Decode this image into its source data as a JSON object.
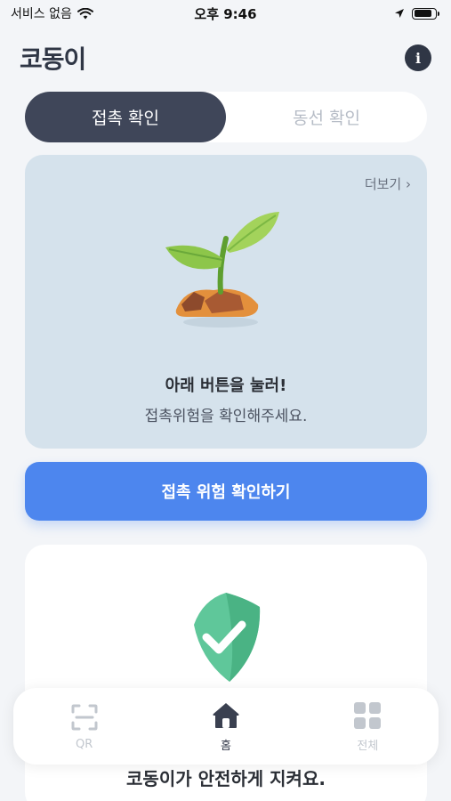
{
  "status_bar": {
    "carrier": "서비스 없음",
    "time": "오후 9:46",
    "battery_level": 0.85
  },
  "header": {
    "logo": "코동이",
    "info_icon": "info-icon",
    "info_glyph": "i"
  },
  "tabs": [
    {
      "label": "접촉 확인",
      "active": true
    },
    {
      "label": "동선 확인",
      "active": false
    }
  ],
  "hero": {
    "more_label": "더보기 ›",
    "illustration": "sprout-icon",
    "title": "아래 버튼을 눌러!",
    "subtitle": "접촉위험을 확인해주세요."
  },
  "cta": {
    "label": "접촉 위험 확인하기",
    "color": "#4d86ee"
  },
  "safety_card": {
    "illustration": "shield-check-icon",
    "message": "코동이가 안전하게 지켜요."
  },
  "bottom_nav": [
    {
      "label": "QR",
      "icon": "qr-scan-icon",
      "active": false
    },
    {
      "label": "홈",
      "icon": "home-icon",
      "active": true
    },
    {
      "label": "전체",
      "icon": "grid-icon",
      "active": false
    }
  ],
  "colors": {
    "accent": "#4d86ee",
    "tab_active": "#3f4659",
    "hero_bg": "#d5e2ec",
    "shield": "#5fc79a"
  }
}
